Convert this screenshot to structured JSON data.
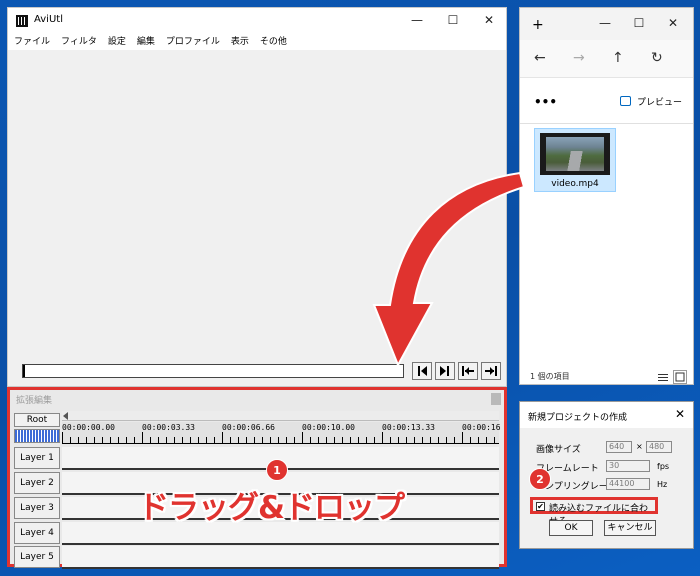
{
  "aviutl": {
    "title": "AviUtl",
    "window_controls": {
      "minimize": "—",
      "maximize": "☐",
      "close": "✕"
    },
    "menu": [
      "ファイル",
      "フィルタ",
      "設定",
      "編集",
      "プロファイル",
      "表示",
      "その他"
    ],
    "nav_buttons": [
      "◀▌",
      "▐▶",
      "|◀",
      "▶|"
    ]
  },
  "explorer": {
    "new_tab": "+",
    "window_controls": {
      "minimize": "—",
      "maximize": "☐",
      "close": "✕"
    },
    "nav": {
      "back": "←",
      "forward": "→",
      "up": "↑",
      "refresh": "↻"
    },
    "more": "•••",
    "preview_label": "プレビュー",
    "file_name": "video.mp4",
    "status": "1 個の項目"
  },
  "timeline": {
    "title": "拡張編集",
    "root_label": "Root",
    "timecodes": [
      "00:00:00.00",
      "00:00:03.33",
      "00:00:06.66",
      "00:00:10.00",
      "00:00:13.33",
      "00:00:16"
    ],
    "layers": [
      "Layer 1",
      "Layer 2",
      "Layer 3",
      "Layer 4",
      "Layer 5"
    ]
  },
  "overlay": {
    "badge1": "1",
    "badge2": "2",
    "drag_drop_text": "ドラッグ&ドロップ"
  },
  "dialog": {
    "title": "新規プロジェクトの作成",
    "close": "✕",
    "image_size_label": "画像サイズ",
    "width": "640",
    "size_separator": "×",
    "height": "480",
    "frame_rate_label": "フレームレート",
    "frame_rate": "30",
    "frame_rate_unit": "fps",
    "sample_rate_label": "サンプリングレート",
    "sample_rate": "44100",
    "sample_rate_unit": "Hz",
    "match_file_label": "読み込むファイルに合わせる",
    "match_file_checked": "✔",
    "ok": "OK",
    "cancel": "キャンセル"
  },
  "colors": {
    "accent_red": "#e0332f",
    "desktop_blue": "#0a4fa6",
    "selection_blue": "#cce8ff"
  }
}
